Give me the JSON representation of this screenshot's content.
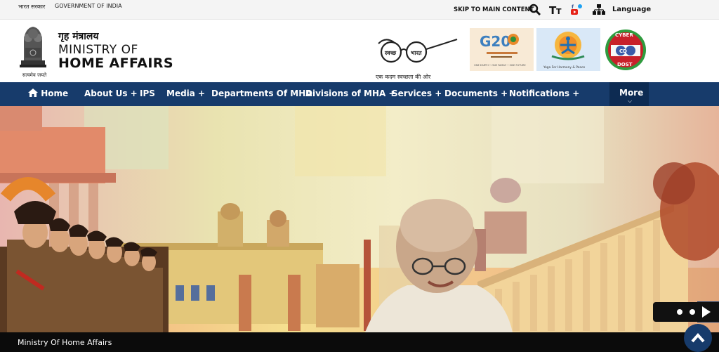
{
  "topbar": {
    "gov_hindi": "भारत सरकार",
    "gov_english": "GOVERNMENT OF INDIA",
    "skip_link": "SKIP TO MAIN CONTENT",
    "language": "Language"
  },
  "header": {
    "emblem_motto": "सत्यमेव जयते",
    "title_hindi": "गृह मंत्रालय",
    "title_line1": "MINISTRY OF",
    "title_line2": "HOME AFFAIRS",
    "swachh_tagline": "एक कदम स्वच्छता की ओर",
    "swachh_left": "स्वच्छ",
    "swachh_right": "भारत",
    "g20_label": "G20",
    "g20_sub": "ONE EARTH • ONE FAMILY • ONE FUTURE",
    "yoga_label": "Yoga For Harmony & Peace",
    "cyber_top": "CYBER",
    "cyber_mid": "CD",
    "cyber_bottom": "DOST"
  },
  "nav": {
    "home": "Home",
    "about": "About Us +",
    "ips": "IPS",
    "media": "Media +",
    "departments": "Departments Of MHA",
    "divisions": "Divisions of MHA +",
    "services": "Services +",
    "documents": "Documents +",
    "notifications": "Notifications +",
    "more": "More"
  },
  "hero": {
    "caption": "Ministry Of Home Affairs"
  },
  "icons": {
    "search": "search-icon",
    "text_size": "text-size-icon",
    "social": "social-media-icon",
    "sitemap": "sitemap-icon",
    "home": "home-icon",
    "next": "chevron-right-icon",
    "play": "play-icon",
    "scroll_top": "chevron-up-icon"
  },
  "colors": {
    "nav_bg": "#173b6b",
    "more_bg": "#0d2b52",
    "caption_bg": "#0b0b0b"
  }
}
